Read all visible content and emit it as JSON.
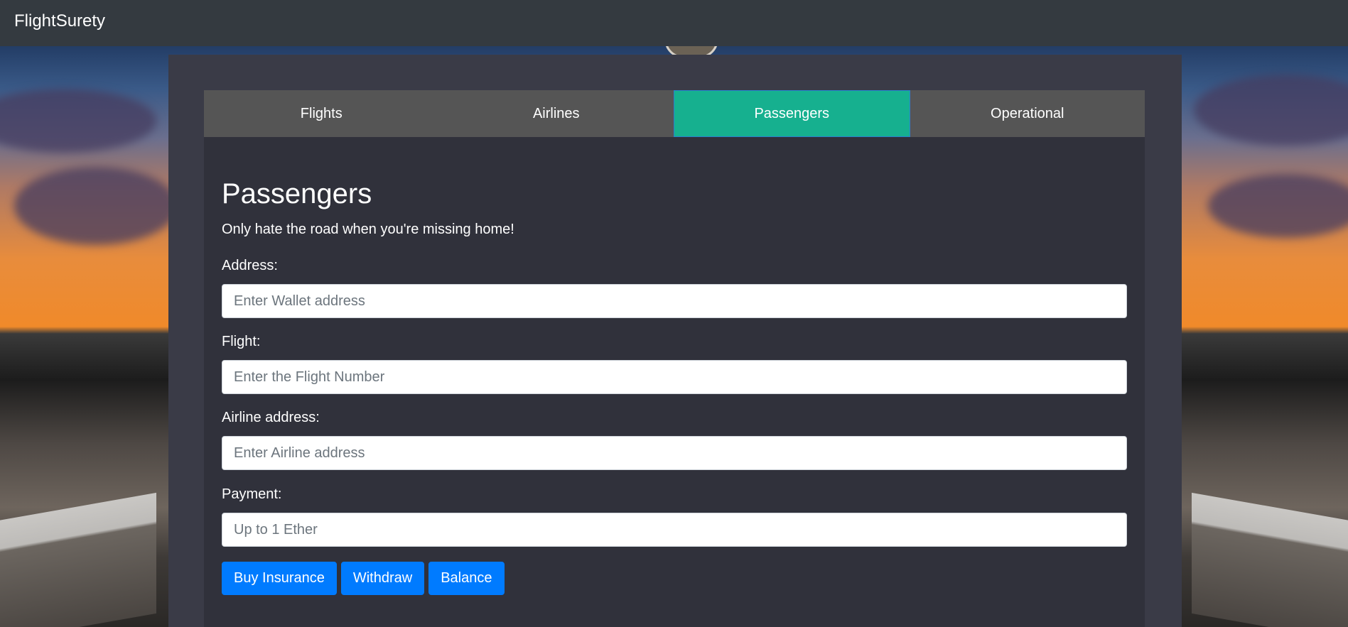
{
  "navbar": {
    "brand": "FlightSurety"
  },
  "tabs": [
    {
      "label": "Flights",
      "active": false
    },
    {
      "label": "Airlines",
      "active": false
    },
    {
      "label": "Passengers",
      "active": true
    },
    {
      "label": "Operational",
      "active": false
    }
  ],
  "passengers": {
    "title": "Passengers",
    "subtitle": "Only hate the road when you're missing home!",
    "fields": {
      "address": {
        "label": "Address:",
        "placeholder": "Enter Wallet address"
      },
      "flight": {
        "label": "Flight:",
        "placeholder": "Enter the Flight Number"
      },
      "airline": {
        "label": "Airline address:",
        "placeholder": "Enter Airline address"
      },
      "payment": {
        "label": "Payment:",
        "placeholder": "Up to 1 Ether"
      }
    },
    "buttons": {
      "buy": "Buy Insurance",
      "withdraw": "Withdraw",
      "balance": "Balance"
    }
  },
  "colors": {
    "navbar": "#343a40",
    "tab": "#555555",
    "tab_active": "#16b08f",
    "content_bg": "#30313b",
    "button": "#007bff"
  }
}
